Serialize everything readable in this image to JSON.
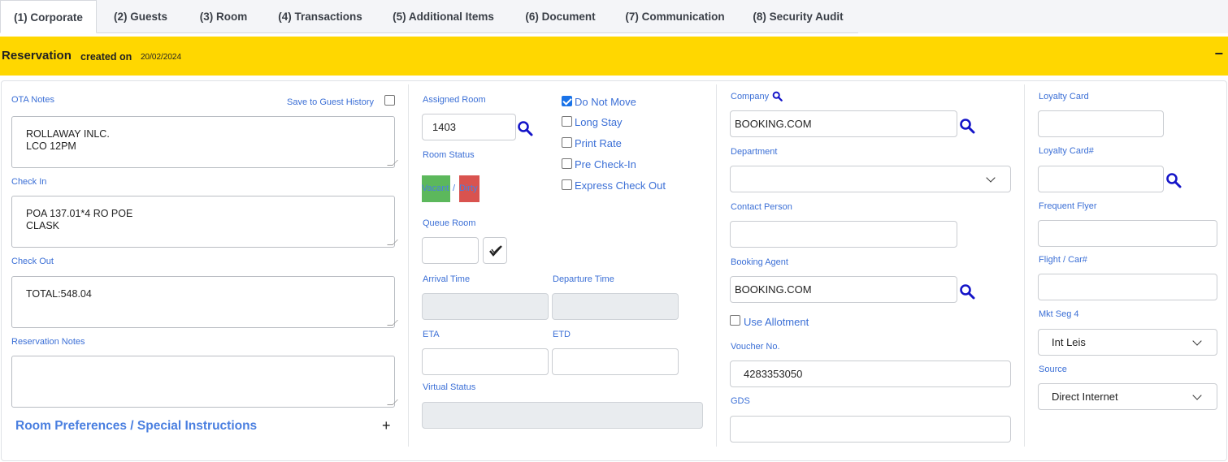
{
  "tabs": [
    {
      "label": "(1) Corporate"
    },
    {
      "label": "(2) Guests"
    },
    {
      "label": "(3) Room"
    },
    {
      "label": "(4) Transactions"
    },
    {
      "label": "(5) Additional Items"
    },
    {
      "label": "(6) Document"
    },
    {
      "label": "(7) Communication"
    },
    {
      "label": "(8) Security Audit"
    }
  ],
  "header": {
    "title": "Reservation",
    "created_label": "created on",
    "created_date": "20/02/2024",
    "collapse_symbol": "−"
  },
  "left": {
    "ota_notes_label": "OTA Notes",
    "save_guest_history_label": "Save to Guest History",
    "ota_notes_value": "ROLLAWAY INLC.\nLCO 12PM",
    "check_in_label": "Check In",
    "check_in_value": "POA 137.01*4 RO POE\nCLASK",
    "check_out_label": "Check Out",
    "check_out_value": "TOTAL:548.04",
    "reservation_notes_label": "Reservation Notes",
    "reservation_notes_value": "",
    "room_prefs_label": "Room Preferences / Special Instructions",
    "expand_symbol": "+"
  },
  "middle": {
    "assigned_room_label": "Assigned Room",
    "assigned_room_value": "1403",
    "room_status_label": "Room Status",
    "status_vacant": "Vacant",
    "status_sep": "/",
    "status_dirty": "Dirty",
    "status_vacant_color": "#5cb85c",
    "status_dirty_color": "#d9534f",
    "queue_room_label": "Queue Room",
    "arrival_time_label": "Arrival Time",
    "departure_time_label": "Departure Time",
    "eta_label": "ETA",
    "etd_label": "ETD",
    "virtual_status_label": "Virtual Status",
    "options": [
      {
        "label": "Do Not Move",
        "checked": true
      },
      {
        "label": "Long Stay",
        "checked": false
      },
      {
        "label": "Print Rate",
        "checked": false
      },
      {
        "label": "Pre Check-In",
        "checked": false
      },
      {
        "label": "Express Check Out",
        "checked": false
      }
    ]
  },
  "company": {
    "company_label": "Company",
    "company_value": "BOOKING.COM",
    "department_label": "Department",
    "department_value": "",
    "contact_person_label": "Contact Person",
    "contact_person_value": "",
    "booking_agent_label": "Booking Agent",
    "booking_agent_value": "BOOKING.COM",
    "use_allotment_label": "Use Allotment",
    "voucher_label": "Voucher No.",
    "voucher_value": "4283353050",
    "gds_label": "GDS",
    "gds_value": ""
  },
  "right": {
    "loyalty_card_label": "Loyalty Card",
    "loyalty_card_no_label": "Loyalty Card#",
    "frequent_flyer_label": "Frequent Flyer",
    "flight_car_label": "Flight / Car#",
    "mkt_seg_label": "Mkt Seg 4",
    "mkt_seg_value": "Int Leis",
    "source_label": "Source",
    "source_value": "Direct Internet"
  },
  "colors": {
    "accent_blue": "#3b6fd6",
    "header_yellow": "#ffd700",
    "search_icon_blue": "#1414c8"
  }
}
